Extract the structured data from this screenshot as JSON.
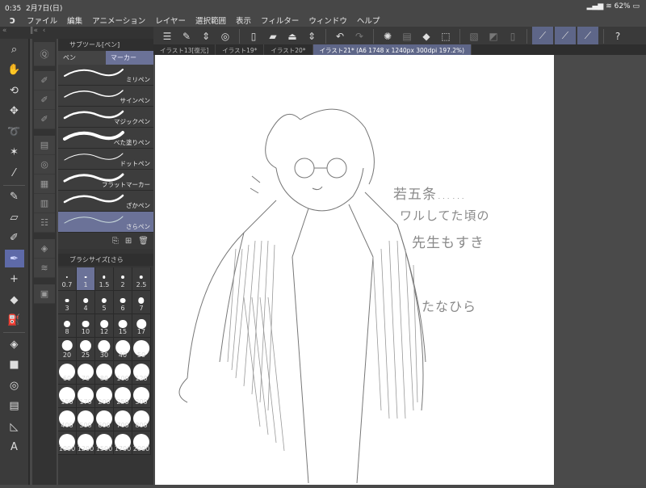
{
  "status": {
    "time": "0:35",
    "date": "2月7日(日)",
    "battery": "62%"
  },
  "menu": [
    "ファイル",
    "編集",
    "アニメーション",
    "レイヤー",
    "選択範囲",
    "表示",
    "フィルター",
    "ウィンドウ",
    "ヘルプ"
  ],
  "tabs": [
    "イラスト13[復元]",
    "イラスト19*",
    "イラスト20*",
    "イラスト21* (A6 1748 x 1240px 300dpi 197.2%)"
  ],
  "subtool": {
    "title": "サブツール[ペン]",
    "tabs": [
      "ペン",
      "マーカー"
    ],
    "items": [
      "ミリペン",
      "サインペン",
      "マジックペン",
      "べた塗りペン",
      "ドットペン",
      "フラットマーカー",
      "ざかペン",
      "さらペン"
    ],
    "selected": 7
  },
  "brushsize": {
    "title": "ブラシサイズ[さら",
    "values": [
      "0.7",
      "1",
      "1.5",
      "2",
      "2.5",
      "3",
      "4",
      "5",
      "6",
      "7",
      "8",
      "10",
      "12",
      "15",
      "17",
      "20",
      "25",
      "30",
      "40",
      "50",
      "60",
      "70",
      "80",
      "100",
      "120",
      "150",
      "170",
      "200",
      "250",
      "300",
      "400",
      "500",
      "600",
      "700",
      "800",
      "1000",
      "1200",
      "1500",
      "1700",
      "2000"
    ],
    "selected": "1"
  },
  "tools": [
    "zoom",
    "hand",
    "rotate",
    "move",
    "lasso",
    "magic-wand",
    "eyedropper",
    "|",
    "pen",
    "eraser",
    "pencil",
    "pen-selected",
    "decoration",
    "blend",
    "airbrush",
    "|",
    "fill",
    "gradient",
    "shape",
    "frame",
    "ruler",
    "text"
  ],
  "artwork": {
    "note": [
      "若五条……",
      "ワルしてた頃の",
      "先生もすき"
    ],
    "signature": "たなひら"
  },
  "colors": {
    "accent": "#5e6688",
    "panel": "#353535"
  }
}
